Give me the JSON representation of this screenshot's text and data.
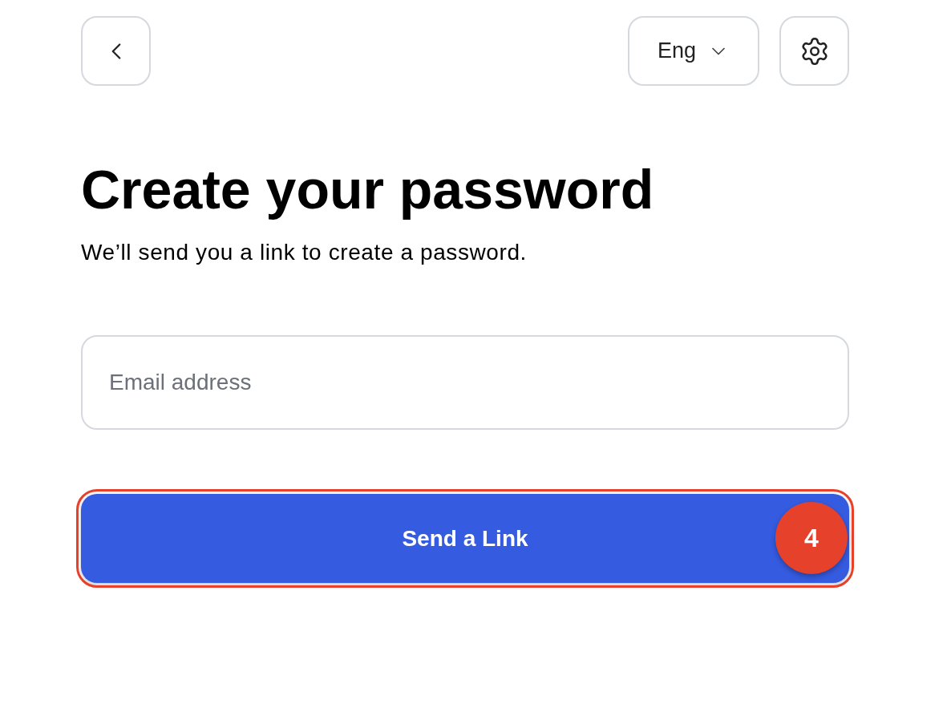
{
  "header": {
    "language_selector": {
      "label": "Eng"
    }
  },
  "title": "Create your password",
  "subtitle": "We’ll send you a link to create a password.",
  "email_field": {
    "placeholder": "Email address"
  },
  "submit_button": {
    "label": "Send a Link",
    "highlighted": true
  },
  "callout": {
    "label": "4"
  }
}
